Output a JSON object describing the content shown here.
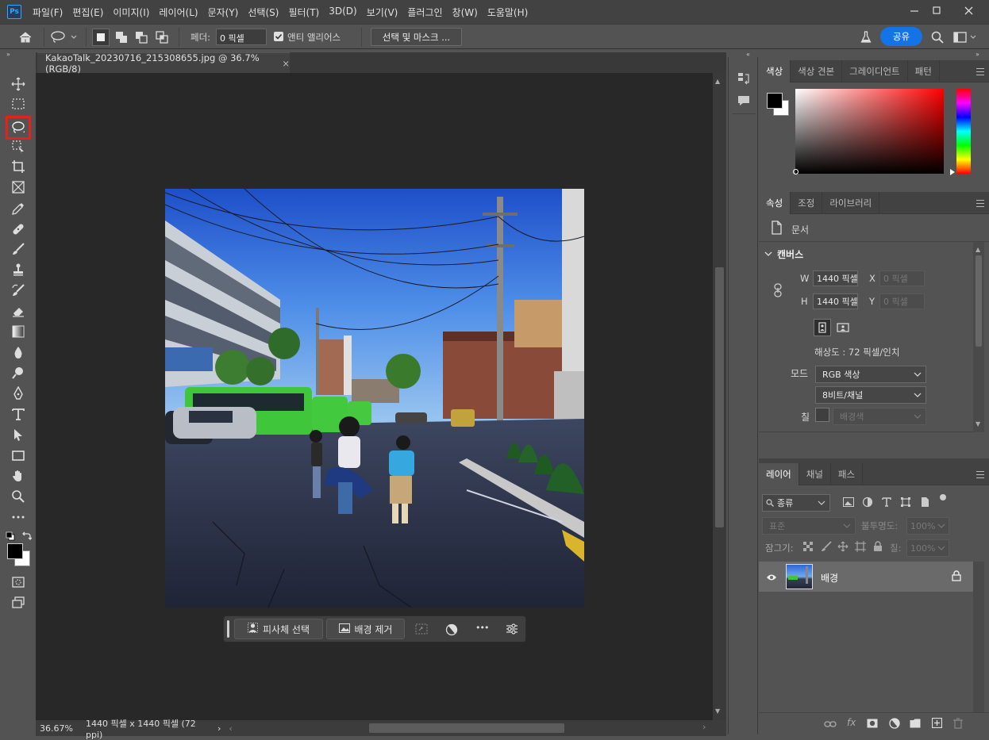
{
  "app": {
    "logo_text": "Ps",
    "menu": [
      "파일(F)",
      "편집(E)",
      "이미지(I)",
      "레이어(L)",
      "문자(Y)",
      "선택(S)",
      "필터(T)",
      "3D(D)",
      "보기(V)",
      "플러그인",
      "창(W)",
      "도움말(H)"
    ]
  },
  "options_bar": {
    "feather_label": "페더:",
    "feather_value": "0 픽셀",
    "antialias_label": "앤티 앨리어스",
    "select_mask_label": "선택 및 마스크 ...",
    "share_label": "공유"
  },
  "document": {
    "tab_title": "KakaoTalk_20230716_215308655.jpg @ 36.7% (RGB/8)",
    "tab_close": "×",
    "zoom": "36.67%",
    "size_info": "1440 픽셀 x 1440 픽셀 (72 ppi)",
    "status_arrow": "›"
  },
  "context_bar": {
    "select_subject": "피사체 선택",
    "remove_bg": "배경 제거",
    "more": "•••"
  },
  "color_panel": {
    "tabs": [
      "색상",
      "색상 견본",
      "그레이디언트",
      "패턴"
    ],
    "active_tab": 0,
    "accent": "#31a8ff"
  },
  "properties_panel": {
    "tabs": [
      "속성",
      "조정",
      "라이브러리"
    ],
    "doc_label": "문서",
    "canvas_section": "캔버스",
    "w_label": "W",
    "w_value": "1440 픽셀",
    "h_label": "H",
    "h_value": "1440 픽셀",
    "x_label": "X",
    "x_value": "0 픽셀",
    "y_label": "Y",
    "y_value": "0 픽셀",
    "resolution": "해상도 : 72 픽셀/인치",
    "mode_label": "모드",
    "mode_value": "RGB 색상",
    "depth_value": "8비트/채널",
    "fill_label": "칠",
    "fill_value": "배경색"
  },
  "layers_panel": {
    "tabs": [
      "레이어",
      "채널",
      "패스"
    ],
    "filter_label": "종류",
    "blend_mode": "표준",
    "opacity_label": "불투명도:",
    "opacity_value": "100%",
    "lock_label": "잠그기:",
    "fill_label": "칠:",
    "fill_value": "100%",
    "layers": [
      {
        "name": "배경",
        "visible": true,
        "locked": true
      }
    ]
  }
}
